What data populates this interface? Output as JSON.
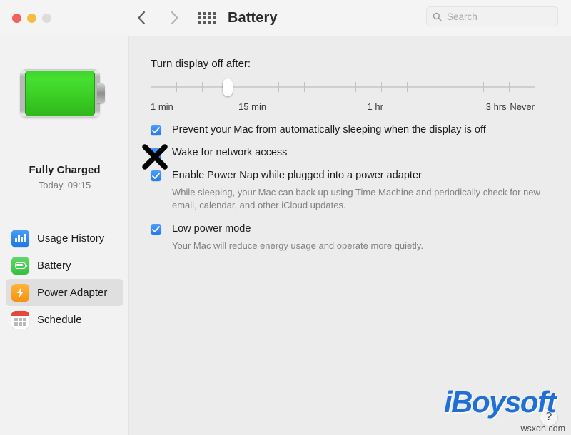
{
  "window": {
    "title": "Battery",
    "traffic_lights": [
      "close",
      "minimize",
      "zoom"
    ],
    "nav": {
      "back": "back-chevron",
      "forward": "forward-chevron",
      "grid": "show-all-grid"
    }
  },
  "search": {
    "placeholder": "Search",
    "value": "",
    "icon": "search-icon"
  },
  "sidebar": {
    "battery_icon": "battery-full-green",
    "status": "Fully Charged",
    "substatus": "Today, 09:15",
    "items": [
      {
        "label": "Usage History",
        "icon": "usage-history-icon",
        "selected": false
      },
      {
        "label": "Battery",
        "icon": "battery-icon",
        "selected": false
      },
      {
        "label": "Power Adapter",
        "icon": "power-adapter-icon",
        "selected": true
      },
      {
        "label": "Schedule",
        "icon": "schedule-icon",
        "selected": false
      }
    ]
  },
  "main": {
    "display_off_label": "Turn display off after:",
    "slider": {
      "tick_count": 16,
      "thumb_position_percent": 20,
      "labels": [
        {
          "text": "1 min",
          "position_percent": 0
        },
        {
          "text": "15 min",
          "position_percent": 26.5
        },
        {
          "text": "1 hr",
          "position_percent": 58.5
        },
        {
          "text": "3 hrs",
          "position_percent": 90
        },
        {
          "text": "Never",
          "position_percent": 100
        }
      ]
    },
    "options": [
      {
        "label": "Prevent your Mac from automatically sleeping when the display is off",
        "checked": true,
        "description": ""
      },
      {
        "label": "Wake for network access",
        "checked": true,
        "description": "",
        "annotated_x": true
      },
      {
        "label": "Enable Power Nap while plugged into a power adapter",
        "checked": true,
        "description": "While sleeping, your Mac can back up using Time Machine and periodically check for new email, calendar, and other iCloud updates."
      },
      {
        "label": "Low power mode",
        "checked": true,
        "description": "Your Mac will reduce energy usage and operate more quietly."
      }
    ],
    "help_label": "?"
  },
  "watermark": {
    "brand": "iBoysoft",
    "url": "wsxdn.com"
  },
  "colors": {
    "accent_blue": "#1f7bf0",
    "battery_green": "#3ccf25",
    "power_orange": "#f59211",
    "brand_blue": "#1f6fd6",
    "sidebar_bg": "#f2f2f2",
    "main_bg": "#ececec"
  }
}
